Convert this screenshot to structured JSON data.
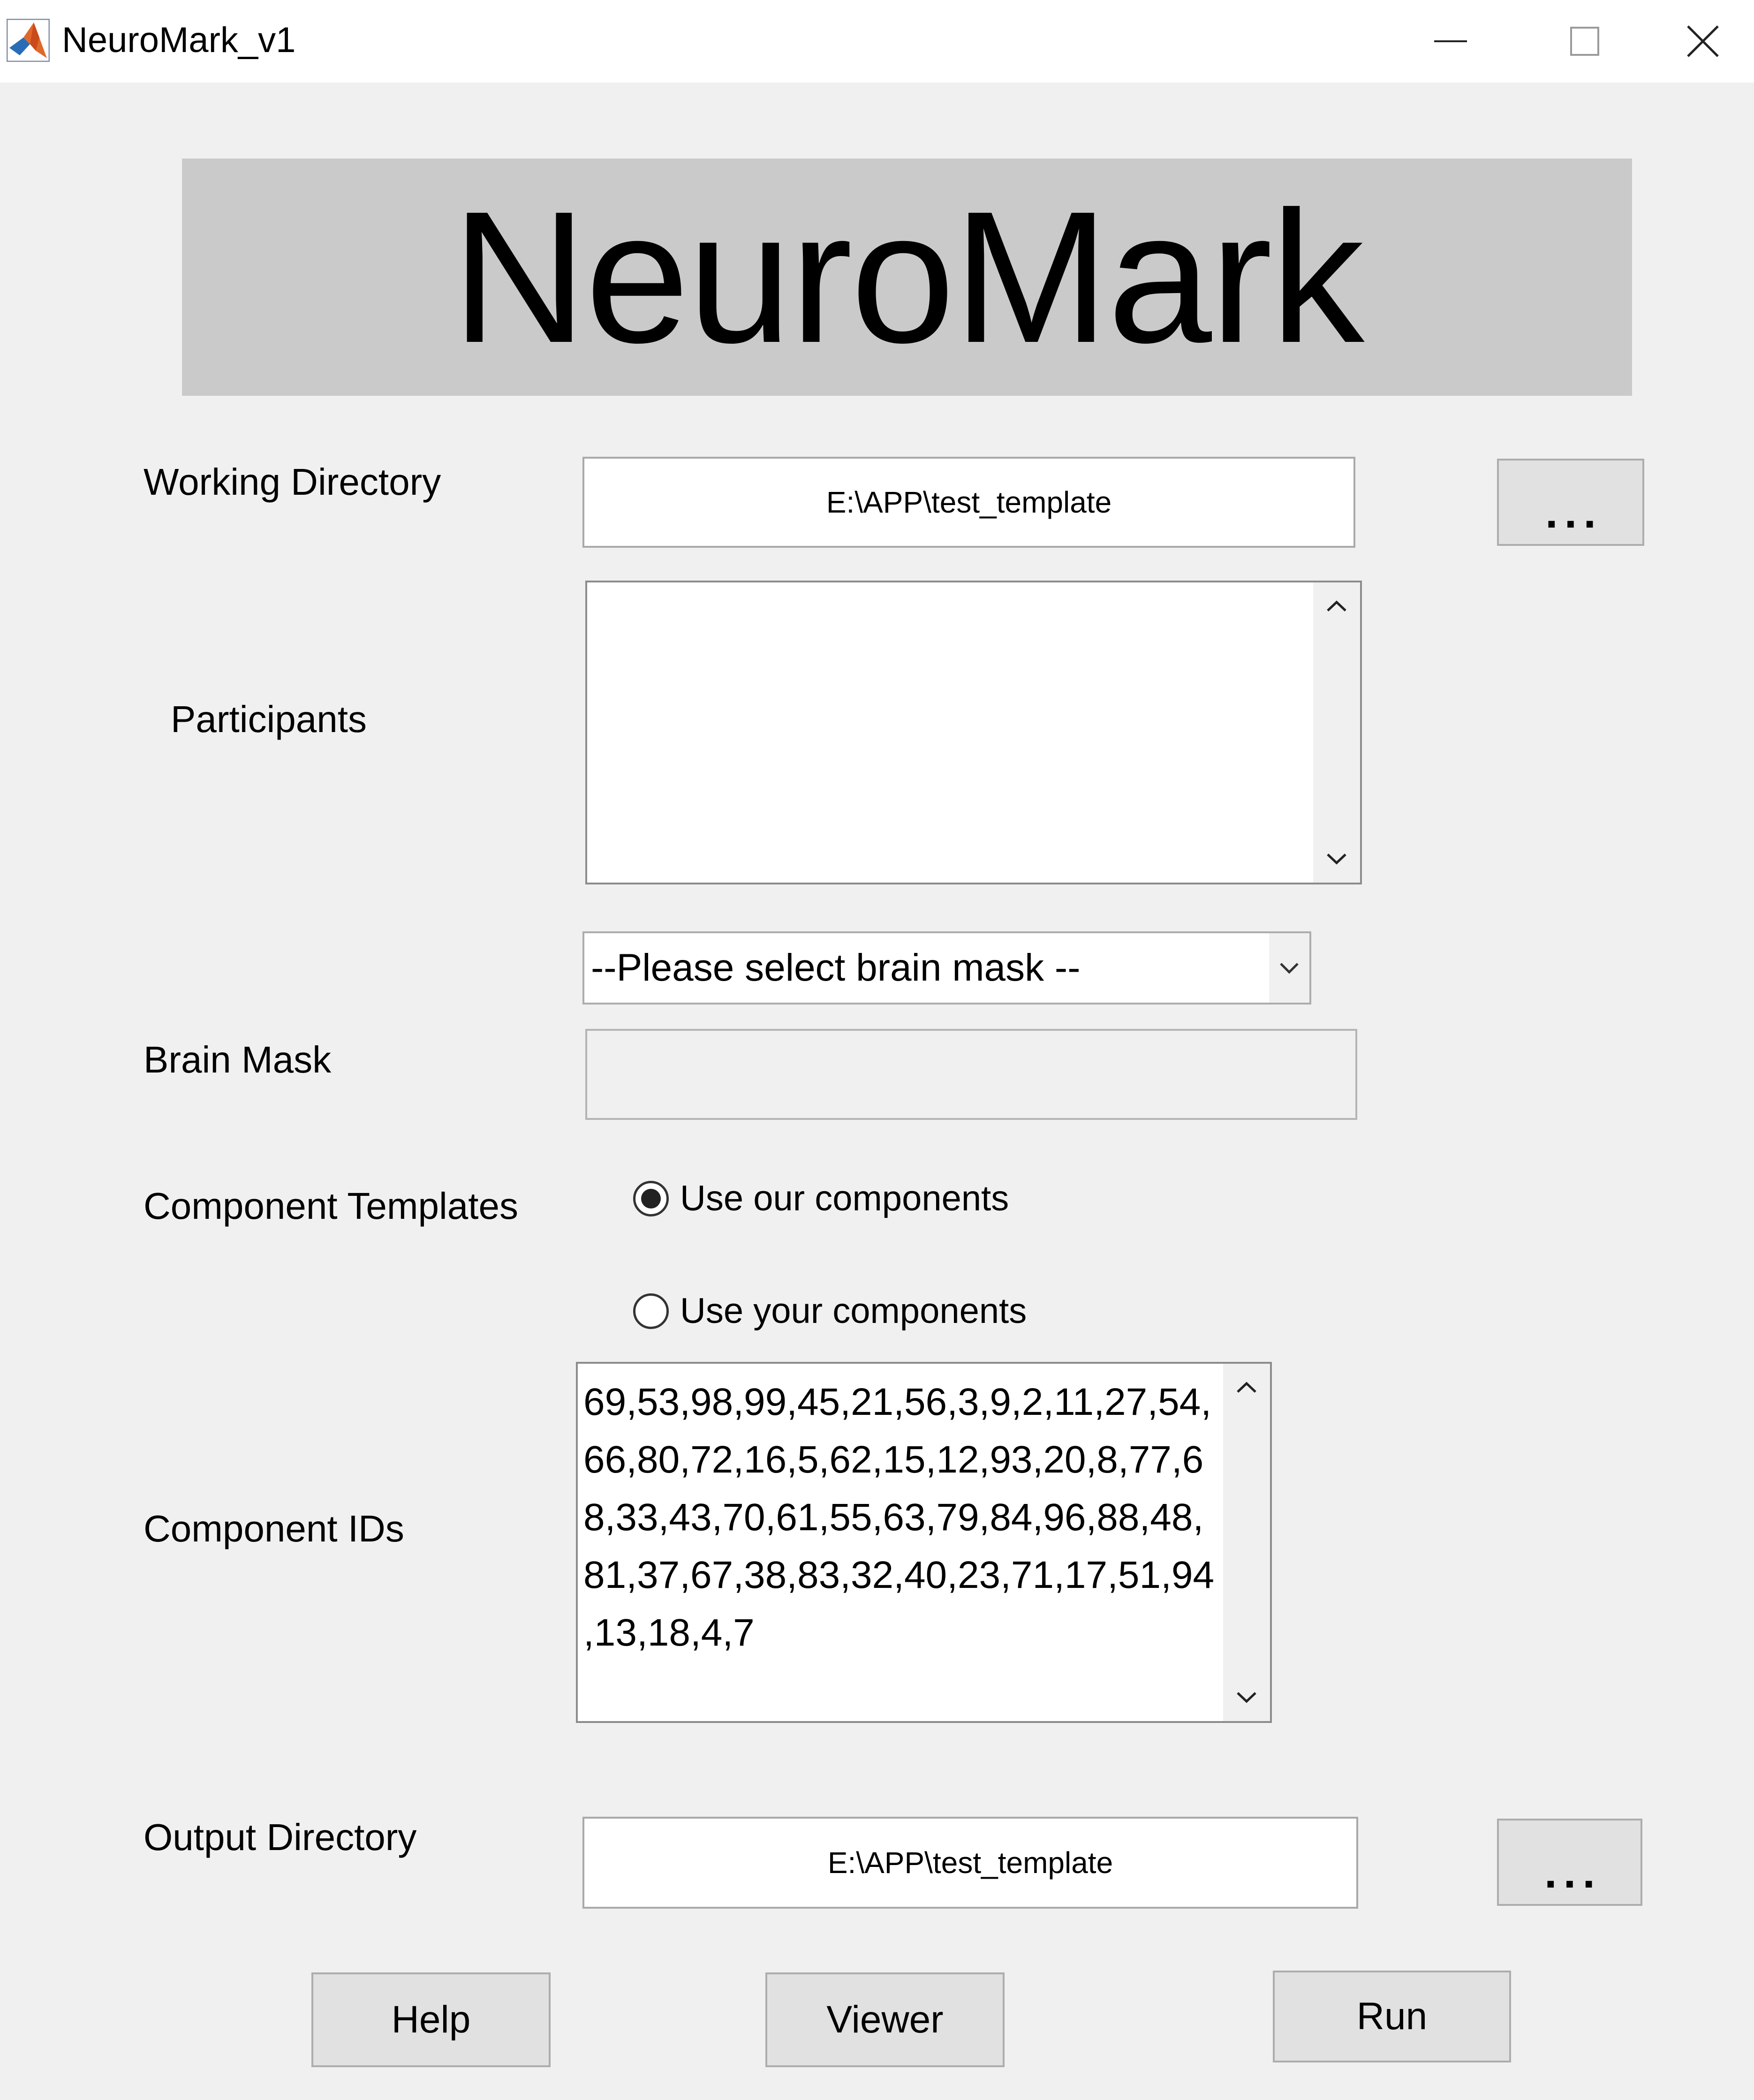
{
  "window": {
    "title": "NeuroMark_v1",
    "icon": "matlab-icon",
    "controls": [
      "minimize-icon",
      "maximize-icon",
      "close-icon"
    ]
  },
  "banner": {
    "title": "NeuroMark"
  },
  "working_directory": {
    "label": "Working Directory",
    "value": "E:\\APP\\test_template",
    "browse_label": "..."
  },
  "participants": {
    "label": "Participants",
    "items": []
  },
  "brain_mask": {
    "label": "Brain Mask",
    "dropdown_selected": "--Please select brain mask --",
    "path_value": ""
  },
  "component_templates": {
    "label": "Component Templates",
    "options": [
      {
        "label": "Use our components",
        "checked": true
      },
      {
        "label": "Use your components",
        "checked": false
      }
    ]
  },
  "component_ids": {
    "label": "Component IDs",
    "lines": [
      "69,53,98,99,45,21,56,3,9,2,11,27,54,",
      "66,80,72,16,5,62,15,12,93,20,8,77,6",
      "8,33,43,70,61,55,63,79,84,96,88,48,",
      "81,37,67,38,83,32,40,23,71,17,51,94",
      ",13,18,4,7"
    ]
  },
  "output_directory": {
    "label": "Output Directory",
    "value": "E:\\APP\\test_template",
    "browse_label": "..."
  },
  "actions": {
    "help": "Help",
    "viewer": "Viewer",
    "run": "Run"
  },
  "colors": {
    "window_bg": "#f0f0f0",
    "banner_bg": "#cacaca",
    "button_bg": "#e1e1e1",
    "field_border": "#a9a9a9"
  }
}
